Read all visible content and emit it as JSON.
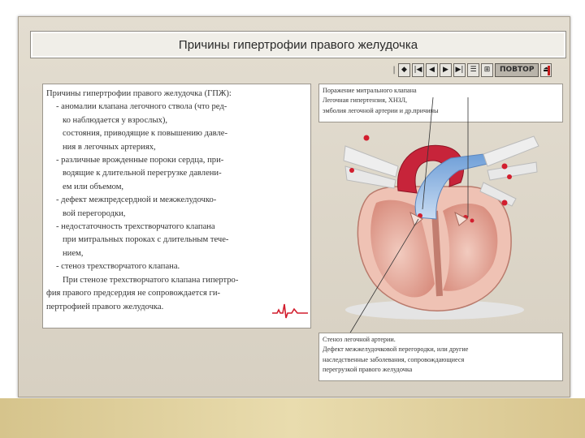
{
  "slide": {
    "title": "Причины гипертрофии правого желудочка"
  },
  "toolbar": {
    "buttons": [
      {
        "name": "help-button",
        "glyph": "◆"
      },
      {
        "name": "first-button",
        "glyph": "|◀"
      },
      {
        "name": "prev-button",
        "glyph": "◀"
      },
      {
        "name": "next-button",
        "glyph": "▶"
      },
      {
        "name": "last-button",
        "glyph": "▶|"
      },
      {
        "name": "list-button",
        "glyph": "☰"
      }
    ],
    "separator": "|",
    "search_glyph": "⊞",
    "repeat_label": "ПОВТОР",
    "exit_glyph": "⏏"
  },
  "text_panel": {
    "lines": [
      "Причины гипертрофии правого желудочка (ГПЖ):",
      "- аномалии клапана легочного ствола (что ред-",
      "ко наблюдается у взрослых),",
      "состояния, приводящие к повышению давле-",
      "ния в легочных артериях,",
      "- различные врожденные пороки сердца, при-",
      "водящие к длительной перегрузке давлени-",
      "ем или объемом,",
      "- дефект межпредсердной и межжелудочко-",
      "вой перегородки,",
      "- недостаточность трехстворчатого клапана",
      "при митральных пороках с длительным тече-",
      "нием,",
      "- стеноз трехстворчатого клапана.",
      "При стенозе трехстворчатого клапана гипертро-",
      "фия правого предсердия не сопровождается ги-",
      "пертрофией правого желудочка."
    ]
  },
  "callouts": {
    "top": [
      "Поражение митрального клапана",
      "Легочная гипертензия, ХНЗЛ,",
      "эмболия легочной артерии и др.причины"
    ],
    "bottom": [
      "Стеноз легочной артерии.",
      "Дефект межжелудочковой перегородки, или другие",
      "наследственные заболевания, сопровождающиеся",
      "перегрузкой правого желудочка"
    ]
  },
  "colors": {
    "frame": "#d7d0c2",
    "band": "#e0d09c",
    "heart_muscle": "#e7b3a6",
    "aorta": "#c7243a",
    "pulmonary": "#8db3e2",
    "accent_red": "#d21e2e"
  }
}
